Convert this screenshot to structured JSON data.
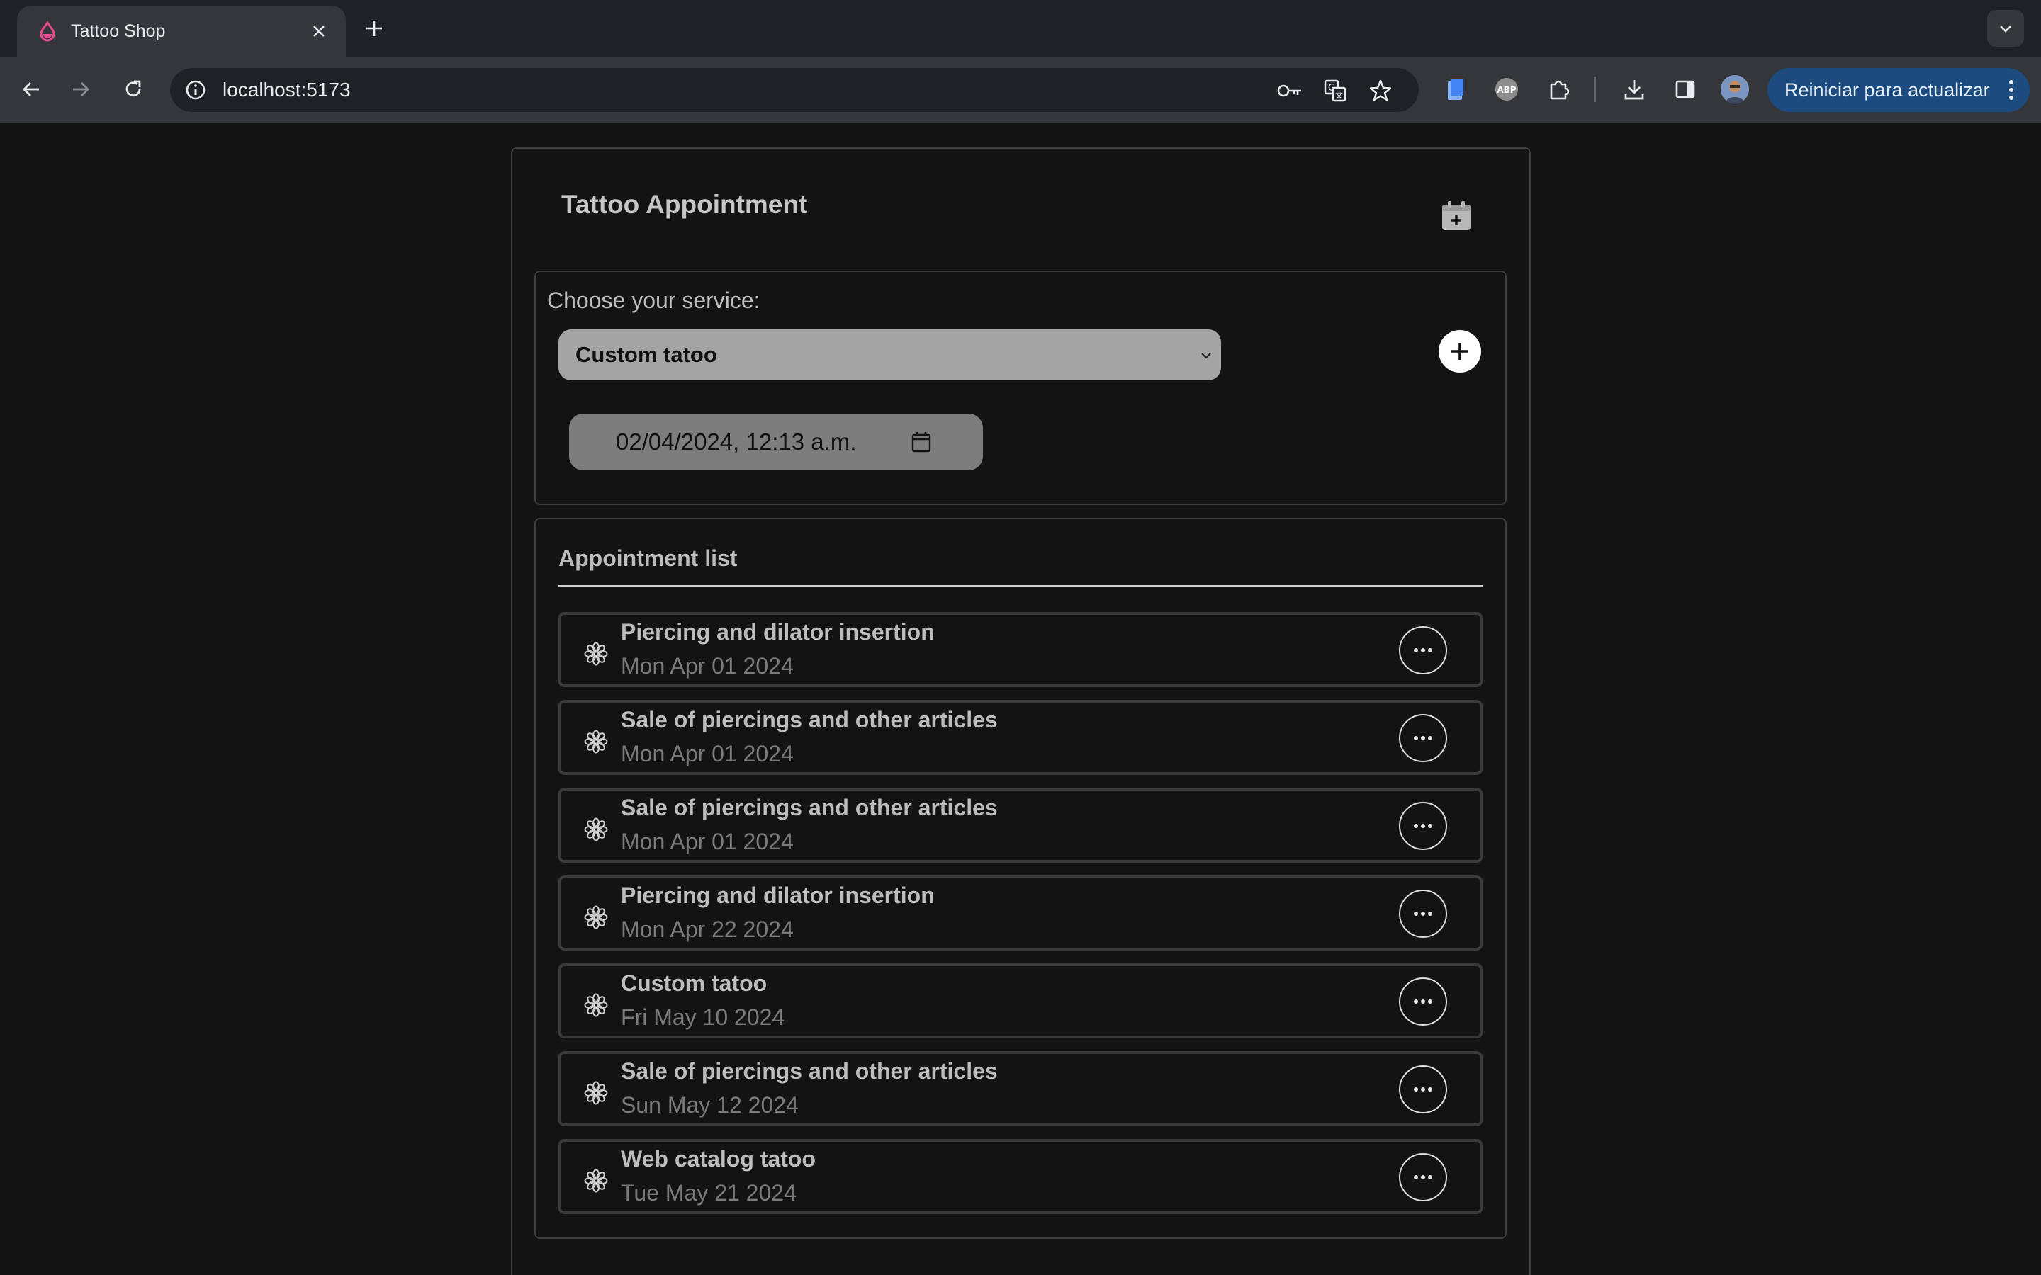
{
  "browser": {
    "tab_title": "Tattoo Shop",
    "url": "localhost:5173",
    "restart_label": "Reiniciar para actualizar",
    "accent": "#1c4b7f"
  },
  "app": {
    "title": "Tattoo Appointment",
    "service_label": "Choose your service:",
    "selected_service": "Custom tatoo",
    "datetime_value": "02/04/2024, 12:13 a.m.",
    "list_title": "Appointment list",
    "colors": {
      "background": "#131313",
      "select_bg": "#a4a4a4",
      "date_bg": "#7d7d7d",
      "border": "#3e3e3e"
    }
  },
  "appointments": [
    {
      "title": "Piercing and dilator insertion",
      "date": "Mon Apr 01 2024"
    },
    {
      "title": "Sale of piercings and other articles",
      "date": "Mon Apr 01 2024"
    },
    {
      "title": "Sale of piercings and other articles",
      "date": "Mon Apr 01 2024"
    },
    {
      "title": "Piercing and dilator insertion",
      "date": "Mon Apr 22 2024"
    },
    {
      "title": "Custom tatoo",
      "date": "Fri May 10 2024"
    },
    {
      "title": "Sale of piercings and other articles",
      "date": "Sun May 12 2024"
    },
    {
      "title": "Web catalog tatoo",
      "date": "Tue May 21 2024"
    }
  ],
  "icons": {
    "tab": "drop-favicon-icon",
    "appointment": "flower-icon",
    "more": "more-horizontal-icon",
    "add": "plus-icon",
    "calendar": "calendar-add-icon"
  }
}
